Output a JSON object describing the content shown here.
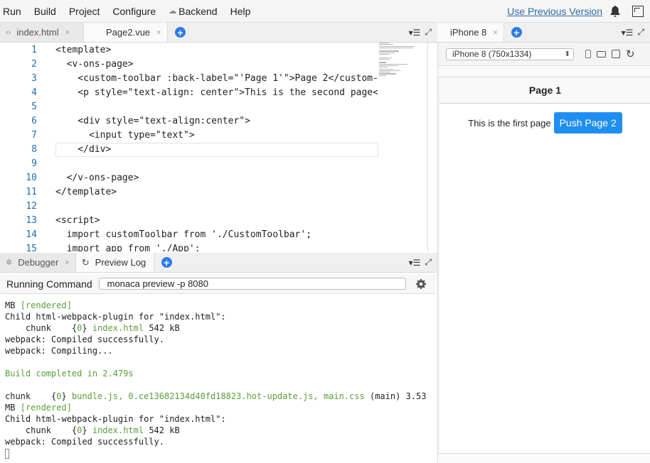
{
  "menu": [
    "Run",
    "Build",
    "Project",
    "Configure",
    "Backend",
    "Help"
  ],
  "top_link": "Use Previous Version",
  "editor_tabs": [
    {
      "label": "index.html",
      "active": false
    },
    {
      "label": "Page2.vue",
      "active": true
    }
  ],
  "preview_tab": "iPhone 8",
  "device_select": "iPhone 8 (750x1334)",
  "code": {
    "line_numbers": [
      "1",
      "2",
      "3",
      "4",
      "5",
      "6",
      "7",
      "8",
      "9",
      "10",
      "11",
      "12",
      "13",
      "14",
      "15"
    ],
    "lines": [
      "<template>",
      "  <v-ons-page>",
      "    <custom-toolbar :back-label=\"'Page 1'\">Page 2</custom-",
      "    <p style=\"text-align: center\">This is the second page<",
      "",
      "    <div style=\"text-align:center\">",
      "      <input type=\"text\">",
      "    </div>",
      "",
      "  </v-ons-page>",
      "</template>",
      "",
      "<script>",
      "  import customToolbar from './CustomToolbar';",
      "  import app from './App';"
    ]
  },
  "bottom_tabs": [
    {
      "label": "Debugger",
      "active": false
    },
    {
      "label": "Preview Log",
      "active": true
    }
  ],
  "run": {
    "label": "Running Command",
    "command": "monaca preview -p 8080"
  },
  "log": {
    "l1_a": "MB ",
    "l1_b": "[rendered]",
    "l2": "Child html-webpack-plugin for \"index.html\":",
    "l3_a": "    chunk    {",
    "l3_b": "0",
    "l3_c": "} ",
    "l3_d": "index.html",
    "l3_e": " 542 kB",
    "l4": "webpack: Compiled successfully.",
    "l5": "webpack: Compiling...",
    "l6": "",
    "l7": "Build completed in 2.479s",
    "l8": "",
    "l9_a": "chunk    {",
    "l9_b": "0",
    "l9_c": "} ",
    "l9_d": "bundle.js, 0.ce13682134d40fd18823.hot-update.js, main.css",
    "l9_e": " (main) 3.53",
    "l10_a": "MB ",
    "l10_b": "[rendered]",
    "l11": "Child html-webpack-plugin for \"index.html\":",
    "l12_a": "    chunk    {",
    "l12_b": "0",
    "l12_c": "} ",
    "l12_d": "index.html",
    "l12_e": " 542 kB",
    "l13": "webpack: Compiled successfully."
  },
  "phone": {
    "toolbar_title": "Page 1",
    "text": "This is the first page",
    "button": "Push Page 2"
  },
  "colors": {
    "accent": "#2c7be5",
    "push_button": "#1f8ef1",
    "line_numbers": "#1f6fb0",
    "log_green": "#5a9e3a",
    "link": "#2d6da8"
  }
}
